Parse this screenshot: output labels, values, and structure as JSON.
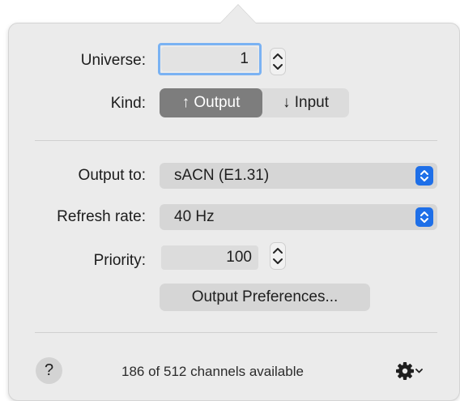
{
  "universe": {
    "label": "Universe:",
    "value": "1"
  },
  "kind": {
    "label": "Kind:",
    "output_label": "↑ Output",
    "input_label": "↓ Input",
    "selected": "output"
  },
  "output_to": {
    "label": "Output to:",
    "value": "sACN (E1.31)"
  },
  "refresh_rate": {
    "label": "Refresh rate:",
    "value": "40 Hz"
  },
  "priority": {
    "label": "Priority:",
    "value": "100"
  },
  "output_preferences_button": "Output Preferences...",
  "footer": {
    "help": "?",
    "status": "186 of 512 channels available"
  },
  "colors": {
    "accent": "#1e6fe8",
    "focus_ring": "#7ab2f3",
    "selected_segment": "#7d7d7d"
  },
  "icons": {
    "help": "question-mark-icon",
    "stepper": "stepper-icon",
    "popup": "popup-chevrons-icon",
    "gear": "gear-icon"
  }
}
